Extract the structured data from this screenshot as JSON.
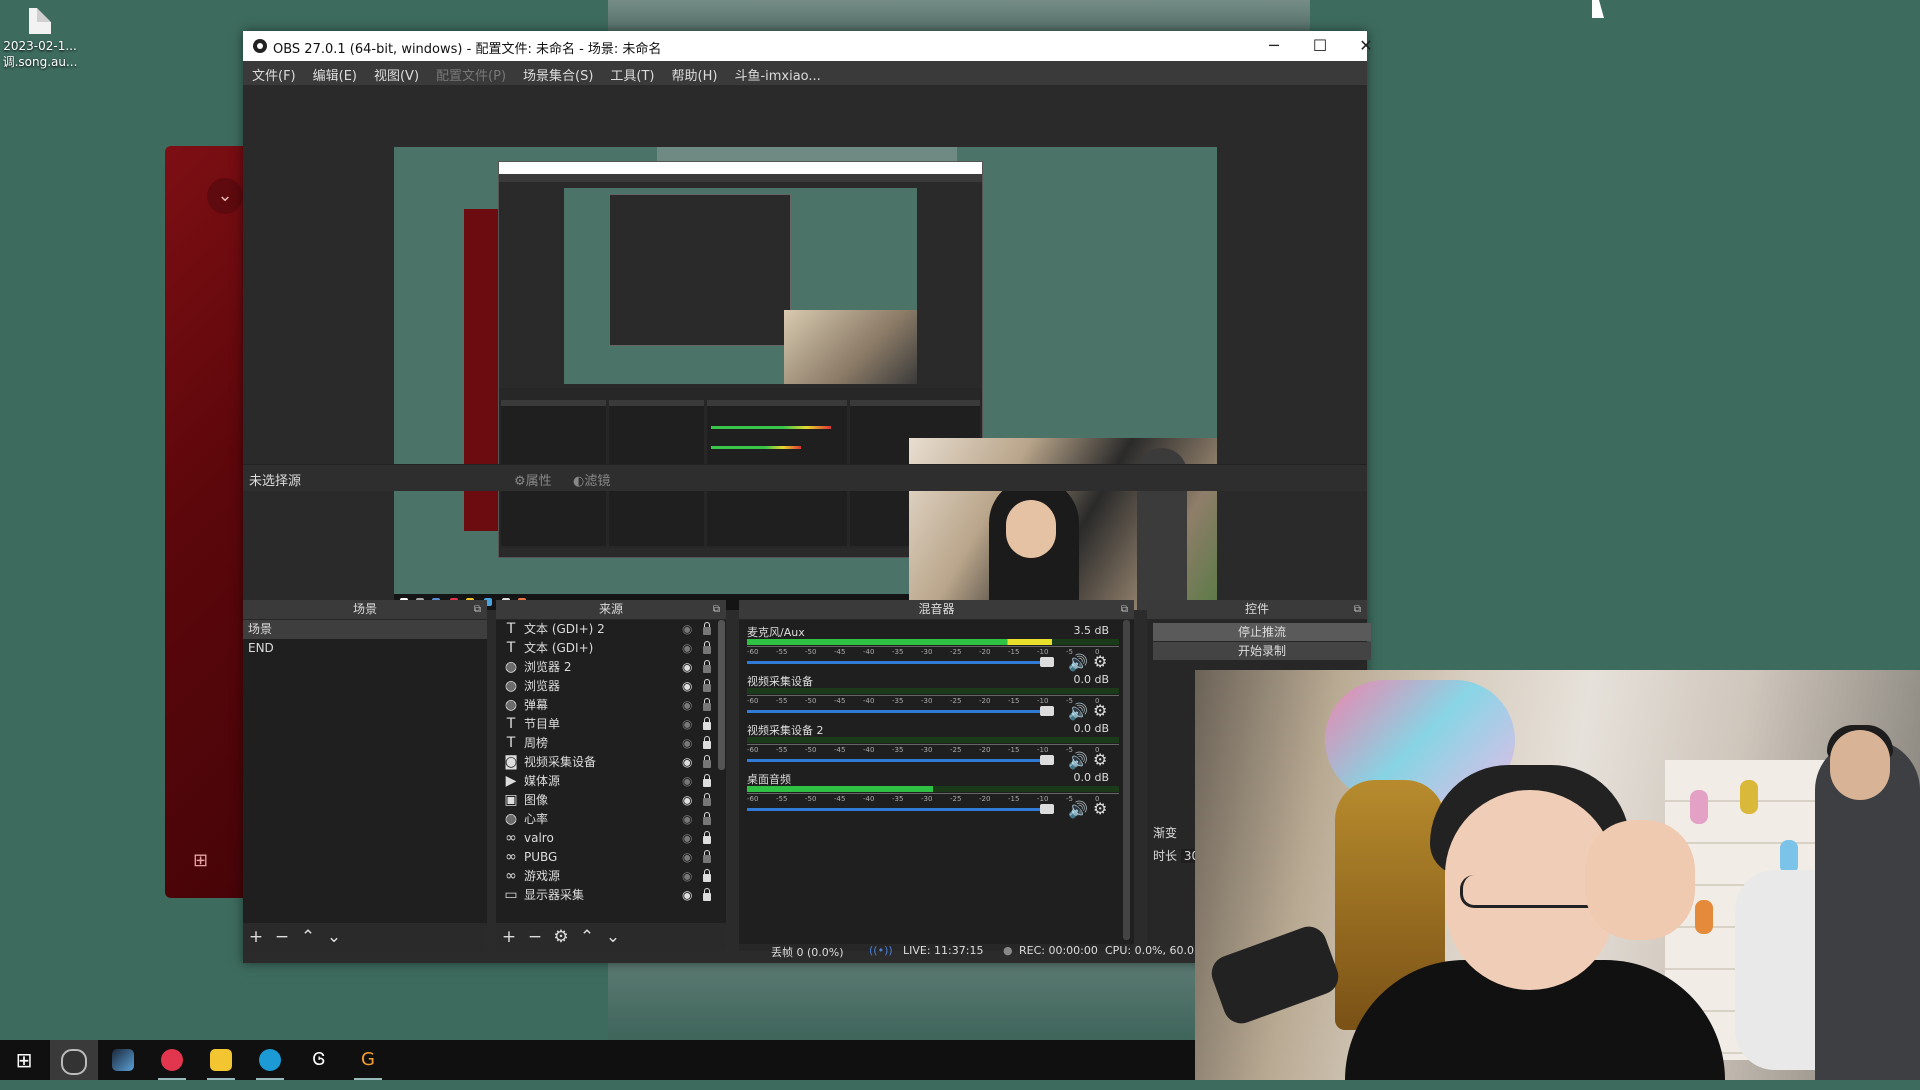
{
  "desktop": {
    "file": {
      "line1": "2023-02-1...",
      "line2": "调.song.au..."
    }
  },
  "obs": {
    "title": "OBS 27.0.1 (64-bit, windows) - 配置文件: 未命名 - 场景: 未命名",
    "window_buttons": {
      "minimize": "─",
      "maximize": "☐",
      "close": "✕"
    },
    "menu": [
      "文件(F)",
      "编辑(E)",
      "视图(V)",
      "配置文件(P)",
      "场景集合(S)",
      "工具(T)",
      "帮助(H)",
      "斗鱼-imxiao..."
    ],
    "source_bar": {
      "no_selection": "未选择源",
      "properties": "属性",
      "filters": "滤镜"
    },
    "scenes": {
      "header": "场景",
      "items": [
        "场景",
        "END"
      ],
      "selected": "场景"
    },
    "sources": {
      "header": "来源",
      "items": [
        {
          "icon": "T",
          "name": "文本 (GDI+) 2",
          "visible": false,
          "locked": false
        },
        {
          "icon": "T",
          "name": "文本 (GDI+)",
          "visible": false,
          "locked": false
        },
        {
          "icon": "◍",
          "name": "浏览器 2",
          "visible": true,
          "locked": false
        },
        {
          "icon": "◍",
          "name": "浏览器",
          "visible": true,
          "locked": false
        },
        {
          "icon": "◍",
          "name": "弹幕",
          "visible": false,
          "locked": false
        },
        {
          "icon": "T",
          "name": "节目单",
          "visible": false,
          "locked": true
        },
        {
          "icon": "T",
          "name": "周榜",
          "visible": false,
          "locked": true
        },
        {
          "icon": "◙",
          "name": "视频采集设备",
          "visible": true,
          "locked": false
        },
        {
          "icon": "▶",
          "name": "媒体源",
          "visible": false,
          "locked": true
        },
        {
          "icon": "▣",
          "name": "图像",
          "visible": true,
          "locked": false
        },
        {
          "icon": "◍",
          "name": "心率",
          "visible": false,
          "locked": false
        },
        {
          "icon": "∞",
          "name": "valro",
          "visible": false,
          "locked": true
        },
        {
          "icon": "∞",
          "name": "PUBG",
          "visible": false,
          "locked": false
        },
        {
          "icon": "∞",
          "name": "游戏源",
          "visible": false,
          "locked": true
        },
        {
          "icon": "▭",
          "name": "显示器采集",
          "visible": true,
          "locked": true
        }
      ]
    },
    "mixer": {
      "header": "混音器",
      "channels": [
        {
          "name": "麦克风/Aux",
          "db": "3.5 dB",
          "level": 0.82,
          "volume": 0.97
        },
        {
          "name": "视频采集设备",
          "db": "0.0 dB",
          "level": 0.0,
          "volume": 0.97
        },
        {
          "name": "视频采集设备 2",
          "db": "0.0 dB",
          "level": 0.0,
          "volume": 0.97
        },
        {
          "name": "桌面音频",
          "db": "0.0 dB",
          "level": 0.5,
          "volume": 0.97
        }
      ],
      "ticks": [
        "-60",
        "-55",
        "-50",
        "-45",
        "-40",
        "-35",
        "-30",
        "-25",
        "-20",
        "-15",
        "-10",
        "-5",
        "0"
      ]
    },
    "controls": {
      "header": "控件",
      "stop_stream": "停止推流",
      "start_record": "开始录制",
      "transition": "渐变",
      "duration_label": "时长",
      "duration_value": "30"
    },
    "status": {
      "dropped": "丢帧 0 (0.0%)",
      "live": "LIVE: 11:37:15",
      "rec": "REC: 00:00:00",
      "cpu": "CPU: 0.0%, 60.0"
    }
  },
  "taskbar": {
    "icons": [
      "windows-start",
      "obs",
      "steam",
      "netease-music",
      "owl-app",
      "ring-app",
      "g-app",
      "g-colored-app"
    ]
  }
}
